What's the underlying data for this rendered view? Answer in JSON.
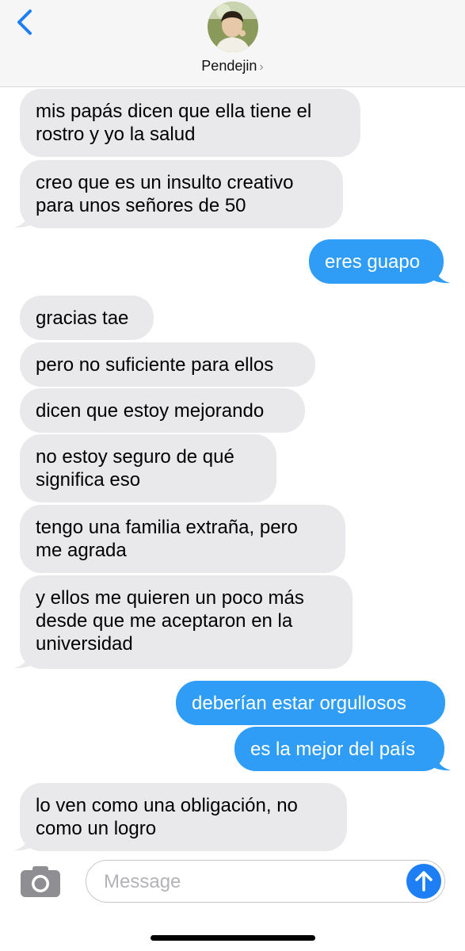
{
  "header": {
    "contact_name": "Pendejin",
    "chevron": "›",
    "back_icon": "chevron-left-icon",
    "accent_color": "#1d7ff3"
  },
  "messages": [
    {
      "from": "them",
      "lines": [
        "mis papás dicen que ella tiene el",
        "rostro y yo la salud"
      ]
    },
    {
      "from": "them",
      "lines": [
        "creo que es un insulto creativo",
        "para unos señores de 50"
      ]
    },
    {
      "from": "me",
      "lines": [
        "eres guapo"
      ]
    },
    {
      "from": "them",
      "lines": [
        "gracias tae"
      ]
    },
    {
      "from": "them",
      "lines": [
        "pero no suficiente para ellos"
      ]
    },
    {
      "from": "them",
      "lines": [
        "dicen que estoy mejorando"
      ]
    },
    {
      "from": "them",
      "lines": [
        "no estoy seguro de qué",
        "significa eso"
      ]
    },
    {
      "from": "them",
      "lines": [
        "tengo una familia extraña, pero",
        "me agrada"
      ]
    },
    {
      "from": "them",
      "lines": [
        "y ellos me quieren un poco más",
        "desde que me aceptaron en la",
        "universidad"
      ]
    },
    {
      "from": "me",
      "lines": [
        "deberían estar orgullosos"
      ]
    },
    {
      "from": "me",
      "lines": [
        "es la mejor del país"
      ]
    },
    {
      "from": "them",
      "lines": [
        "lo ven como una obligación, no",
        "como un logro"
      ]
    }
  ],
  "composer": {
    "placeholder": "Message",
    "camera_icon": "camera-icon",
    "send_icon": "arrow-up-icon"
  },
  "colors": {
    "incoming_bubble": "#e9e9eb",
    "outgoing_bubble": "#2f9cf5",
    "header_bg": "#f6f6f6"
  }
}
